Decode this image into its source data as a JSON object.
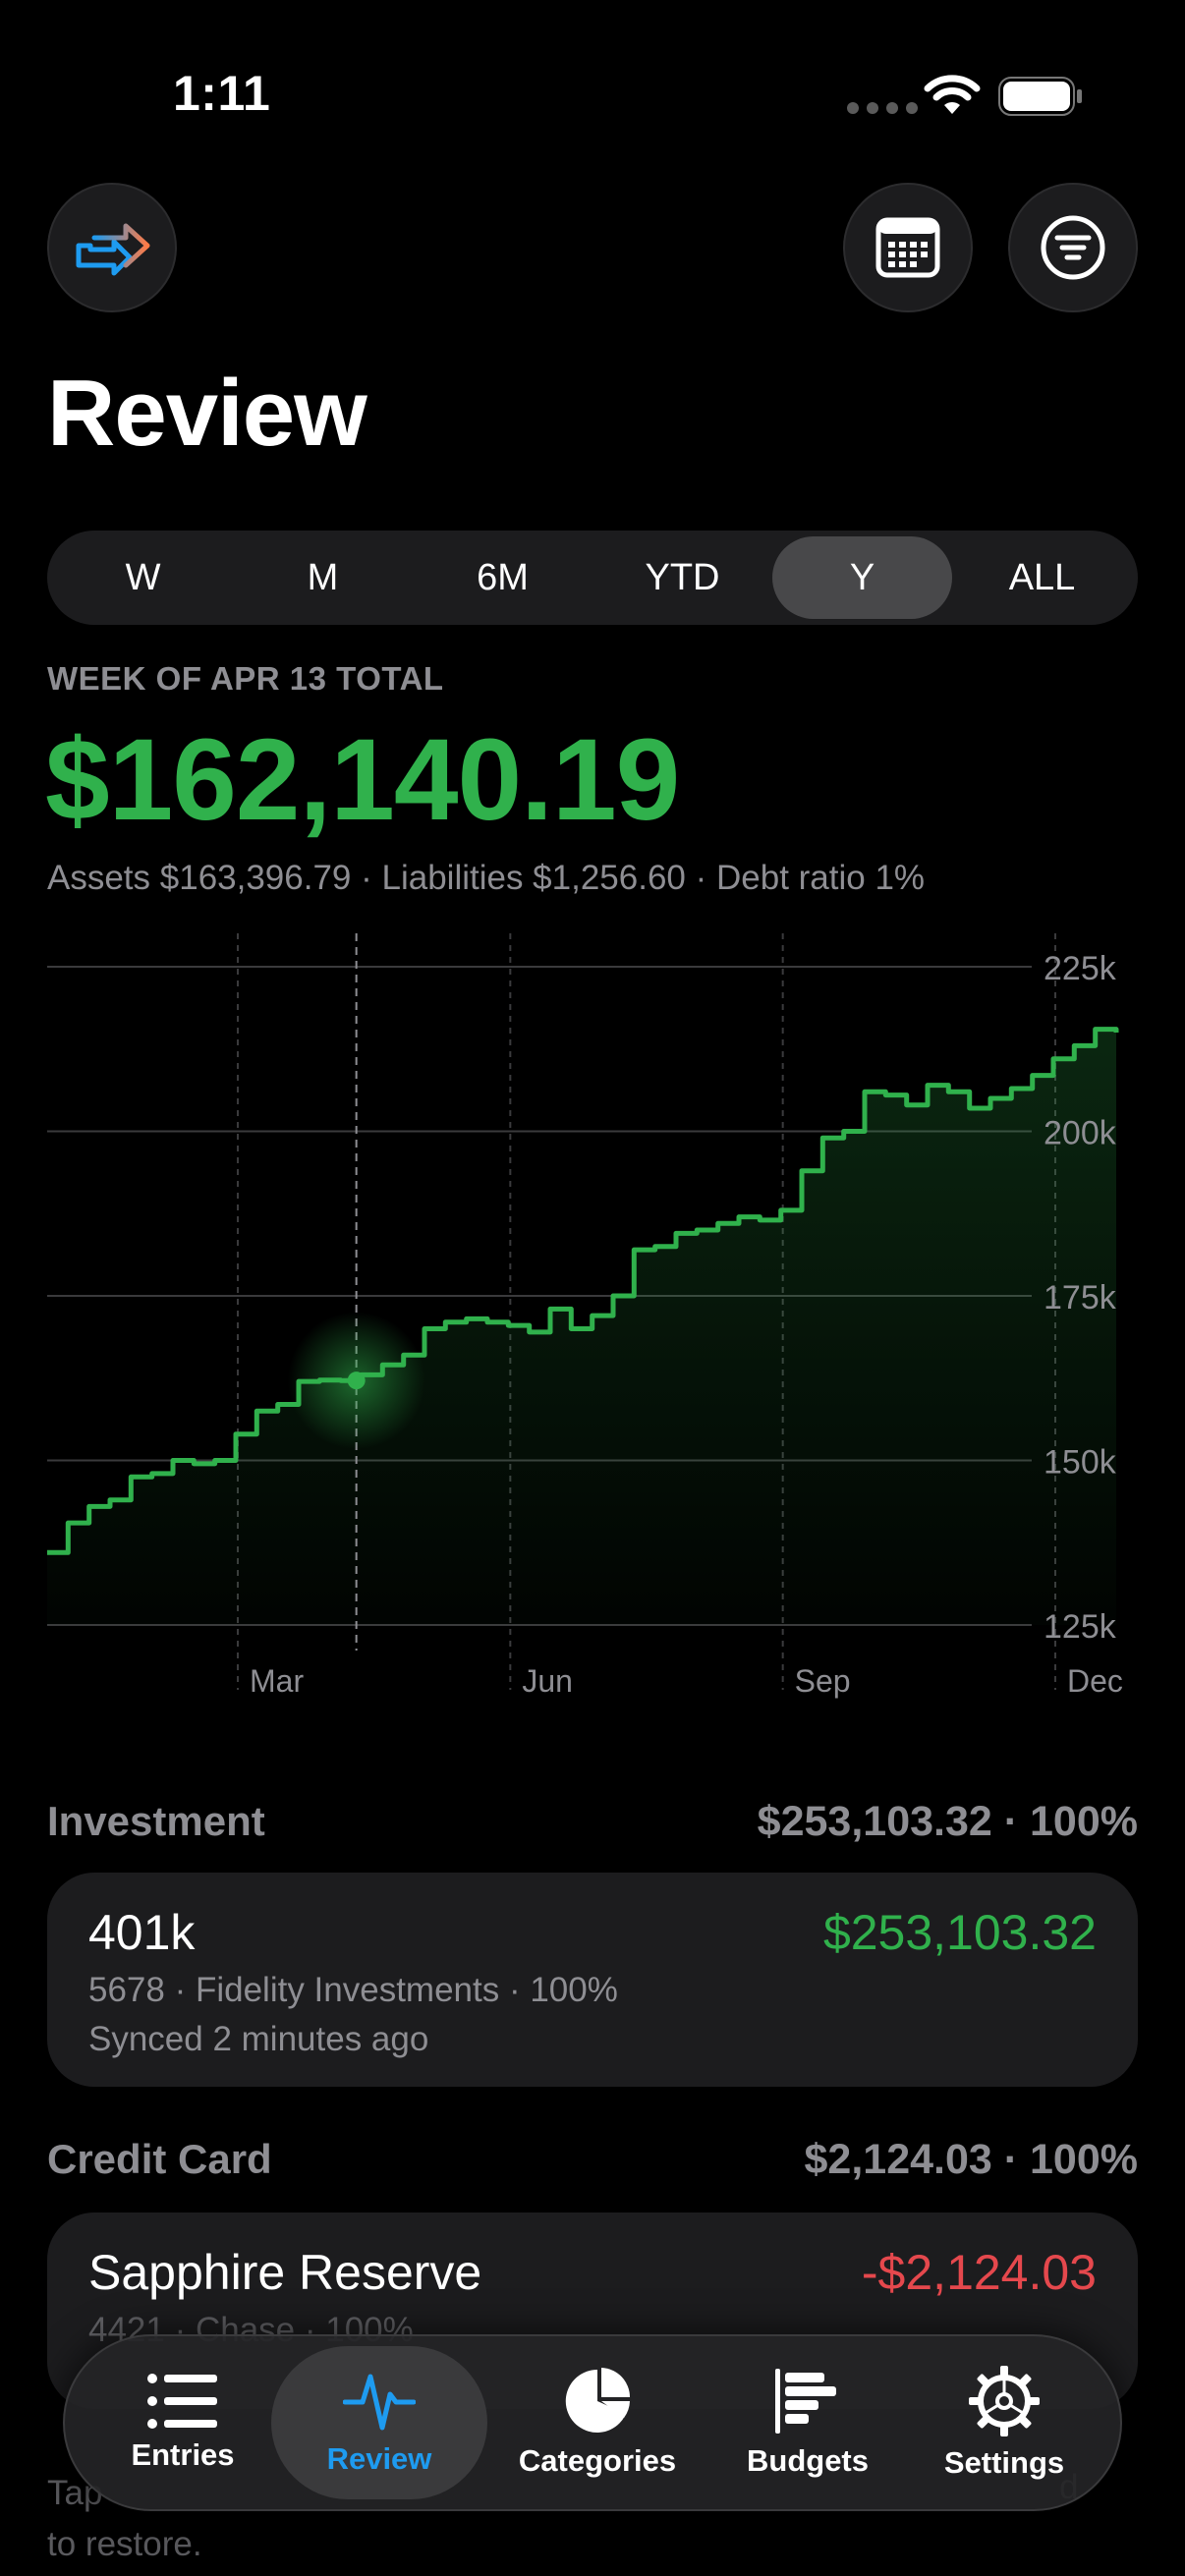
{
  "status": {
    "time": "1:11"
  },
  "header": {
    "title": "Review",
    "logo_icon": "share-arrow-icon",
    "calendar_icon": "calendar-icon",
    "filter_icon": "filter-icon"
  },
  "segments": [
    {
      "label": "W",
      "active": false
    },
    {
      "label": "M",
      "active": false
    },
    {
      "label": "6M",
      "active": false
    },
    {
      "label": "YTD",
      "active": false
    },
    {
      "label": "Y",
      "active": true
    },
    {
      "label": "ALL",
      "active": false
    }
  ],
  "summary": {
    "period_label": "WEEK OF APR 13 TOTAL",
    "total": "$162,140.19",
    "details": "Assets $163,396.79 · Liabilities $1,256.60 · Debt ratio 1%"
  },
  "colors": {
    "positive": "#30b14c",
    "negative": "#e5484d",
    "accent": "#1e9bf0"
  },
  "chart_data": {
    "type": "line",
    "style": "step",
    "y_tick_labels": [
      "225k",
      "200k",
      "175k",
      "150k",
      "125k"
    ],
    "y_ticks": [
      225000,
      200000,
      175000,
      150000,
      125000
    ],
    "ylim": [
      125000,
      225000
    ],
    "x_tick_labels": [
      "Mar",
      "Jun",
      "Sep",
      "Dec"
    ],
    "x_tick_weeks": [
      10,
      23,
      36,
      49
    ],
    "x_range_weeks": [
      1,
      52
    ],
    "selected_week": 15,
    "selected_value": 162140,
    "grid": true,
    "series": [
      {
        "values": [
          136000,
          140500,
          143000,
          144000,
          147500,
          148000,
          150000,
          149500,
          150000,
          154000,
          157500,
          158500,
          162000,
          162200,
          162140,
          163000,
          164500,
          166000,
          170000,
          171000,
          171500,
          171000,
          170500,
          169500,
          173000,
          170000,
          172000,
          175000,
          182000,
          182500,
          184500,
          185000,
          186000,
          187000,
          186500,
          188000,
          194000,
          199000,
          200000,
          206000,
          205500,
          204000,
          207000,
          206000,
          203500,
          205000,
          206500,
          208500,
          211000,
          213000,
          215500,
          215000
        ]
      }
    ]
  },
  "sections": [
    {
      "title": "Investment",
      "total": "$253,103.32",
      "percent": "· 100%",
      "accounts": [
        {
          "name": "401k",
          "amount": "$253,103.32",
          "meta": "5678 · Fidelity Investments · 100%",
          "synced": "Synced 2 minutes ago",
          "tone": "positive"
        }
      ]
    },
    {
      "title": "Credit Card",
      "total": "$2,124.03",
      "percent": "· 100%",
      "accounts": [
        {
          "name": "Sapphire Reserve",
          "amount": "-$2,124.03",
          "meta": "4421 · Chase · 100%",
          "tone": "negative"
        }
      ]
    }
  ],
  "footer_hint": {
    "line1": "Tap",
    "line2": "to restore.",
    "right": "d"
  },
  "tabbar": [
    {
      "label": "Entries",
      "icon": "list-icon",
      "active": false
    },
    {
      "label": "Review",
      "icon": "pulse-icon",
      "active": true
    },
    {
      "label": "Categories",
      "icon": "pie-chart-icon",
      "active": false
    },
    {
      "label": "Budgets",
      "icon": "bar-chart-icon",
      "active": false
    },
    {
      "label": "Settings",
      "icon": "gear-icon",
      "active": false
    }
  ]
}
